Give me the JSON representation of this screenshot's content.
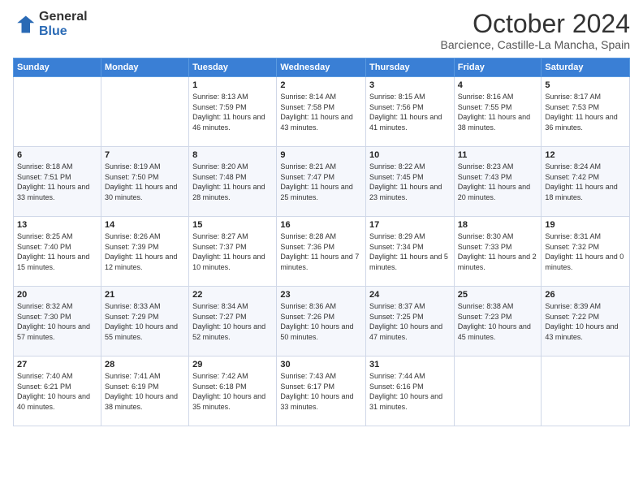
{
  "header": {
    "logo_general": "General",
    "logo_blue": "Blue",
    "month_title": "October 2024",
    "subtitle": "Barcience, Castille-La Mancha, Spain"
  },
  "columns": [
    "Sunday",
    "Monday",
    "Tuesday",
    "Wednesday",
    "Thursday",
    "Friday",
    "Saturday"
  ],
  "weeks": [
    [
      {
        "day": "",
        "sunrise": "",
        "sunset": "",
        "daylight": ""
      },
      {
        "day": "",
        "sunrise": "",
        "sunset": "",
        "daylight": ""
      },
      {
        "day": "1",
        "sunrise": "Sunrise: 8:13 AM",
        "sunset": "Sunset: 7:59 PM",
        "daylight": "Daylight: 11 hours and 46 minutes."
      },
      {
        "day": "2",
        "sunrise": "Sunrise: 8:14 AM",
        "sunset": "Sunset: 7:58 PM",
        "daylight": "Daylight: 11 hours and 43 minutes."
      },
      {
        "day": "3",
        "sunrise": "Sunrise: 8:15 AM",
        "sunset": "Sunset: 7:56 PM",
        "daylight": "Daylight: 11 hours and 41 minutes."
      },
      {
        "day": "4",
        "sunrise": "Sunrise: 8:16 AM",
        "sunset": "Sunset: 7:55 PM",
        "daylight": "Daylight: 11 hours and 38 minutes."
      },
      {
        "day": "5",
        "sunrise": "Sunrise: 8:17 AM",
        "sunset": "Sunset: 7:53 PM",
        "daylight": "Daylight: 11 hours and 36 minutes."
      }
    ],
    [
      {
        "day": "6",
        "sunrise": "Sunrise: 8:18 AM",
        "sunset": "Sunset: 7:51 PM",
        "daylight": "Daylight: 11 hours and 33 minutes."
      },
      {
        "day": "7",
        "sunrise": "Sunrise: 8:19 AM",
        "sunset": "Sunset: 7:50 PM",
        "daylight": "Daylight: 11 hours and 30 minutes."
      },
      {
        "day": "8",
        "sunrise": "Sunrise: 8:20 AM",
        "sunset": "Sunset: 7:48 PM",
        "daylight": "Daylight: 11 hours and 28 minutes."
      },
      {
        "day": "9",
        "sunrise": "Sunrise: 8:21 AM",
        "sunset": "Sunset: 7:47 PM",
        "daylight": "Daylight: 11 hours and 25 minutes."
      },
      {
        "day": "10",
        "sunrise": "Sunrise: 8:22 AM",
        "sunset": "Sunset: 7:45 PM",
        "daylight": "Daylight: 11 hours and 23 minutes."
      },
      {
        "day": "11",
        "sunrise": "Sunrise: 8:23 AM",
        "sunset": "Sunset: 7:43 PM",
        "daylight": "Daylight: 11 hours and 20 minutes."
      },
      {
        "day": "12",
        "sunrise": "Sunrise: 8:24 AM",
        "sunset": "Sunset: 7:42 PM",
        "daylight": "Daylight: 11 hours and 18 minutes."
      }
    ],
    [
      {
        "day": "13",
        "sunrise": "Sunrise: 8:25 AM",
        "sunset": "Sunset: 7:40 PM",
        "daylight": "Daylight: 11 hours and 15 minutes."
      },
      {
        "day": "14",
        "sunrise": "Sunrise: 8:26 AM",
        "sunset": "Sunset: 7:39 PM",
        "daylight": "Daylight: 11 hours and 12 minutes."
      },
      {
        "day": "15",
        "sunrise": "Sunrise: 8:27 AM",
        "sunset": "Sunset: 7:37 PM",
        "daylight": "Daylight: 11 hours and 10 minutes."
      },
      {
        "day": "16",
        "sunrise": "Sunrise: 8:28 AM",
        "sunset": "Sunset: 7:36 PM",
        "daylight": "Daylight: 11 hours and 7 minutes."
      },
      {
        "day": "17",
        "sunrise": "Sunrise: 8:29 AM",
        "sunset": "Sunset: 7:34 PM",
        "daylight": "Daylight: 11 hours and 5 minutes."
      },
      {
        "day": "18",
        "sunrise": "Sunrise: 8:30 AM",
        "sunset": "Sunset: 7:33 PM",
        "daylight": "Daylight: 11 hours and 2 minutes."
      },
      {
        "day": "19",
        "sunrise": "Sunrise: 8:31 AM",
        "sunset": "Sunset: 7:32 PM",
        "daylight": "Daylight: 11 hours and 0 minutes."
      }
    ],
    [
      {
        "day": "20",
        "sunrise": "Sunrise: 8:32 AM",
        "sunset": "Sunset: 7:30 PM",
        "daylight": "Daylight: 10 hours and 57 minutes."
      },
      {
        "day": "21",
        "sunrise": "Sunrise: 8:33 AM",
        "sunset": "Sunset: 7:29 PM",
        "daylight": "Daylight: 10 hours and 55 minutes."
      },
      {
        "day": "22",
        "sunrise": "Sunrise: 8:34 AM",
        "sunset": "Sunset: 7:27 PM",
        "daylight": "Daylight: 10 hours and 52 minutes."
      },
      {
        "day": "23",
        "sunrise": "Sunrise: 8:36 AM",
        "sunset": "Sunset: 7:26 PM",
        "daylight": "Daylight: 10 hours and 50 minutes."
      },
      {
        "day": "24",
        "sunrise": "Sunrise: 8:37 AM",
        "sunset": "Sunset: 7:25 PM",
        "daylight": "Daylight: 10 hours and 47 minutes."
      },
      {
        "day": "25",
        "sunrise": "Sunrise: 8:38 AM",
        "sunset": "Sunset: 7:23 PM",
        "daylight": "Daylight: 10 hours and 45 minutes."
      },
      {
        "day": "26",
        "sunrise": "Sunrise: 8:39 AM",
        "sunset": "Sunset: 7:22 PM",
        "daylight": "Daylight: 10 hours and 43 minutes."
      }
    ],
    [
      {
        "day": "27",
        "sunrise": "Sunrise: 7:40 AM",
        "sunset": "Sunset: 6:21 PM",
        "daylight": "Daylight: 10 hours and 40 minutes."
      },
      {
        "day": "28",
        "sunrise": "Sunrise: 7:41 AM",
        "sunset": "Sunset: 6:19 PM",
        "daylight": "Daylight: 10 hours and 38 minutes."
      },
      {
        "day": "29",
        "sunrise": "Sunrise: 7:42 AM",
        "sunset": "Sunset: 6:18 PM",
        "daylight": "Daylight: 10 hours and 35 minutes."
      },
      {
        "day": "30",
        "sunrise": "Sunrise: 7:43 AM",
        "sunset": "Sunset: 6:17 PM",
        "daylight": "Daylight: 10 hours and 33 minutes."
      },
      {
        "day": "31",
        "sunrise": "Sunrise: 7:44 AM",
        "sunset": "Sunset: 6:16 PM",
        "daylight": "Daylight: 10 hours and 31 minutes."
      },
      {
        "day": "",
        "sunrise": "",
        "sunset": "",
        "daylight": ""
      },
      {
        "day": "",
        "sunrise": "",
        "sunset": "",
        "daylight": ""
      }
    ]
  ]
}
